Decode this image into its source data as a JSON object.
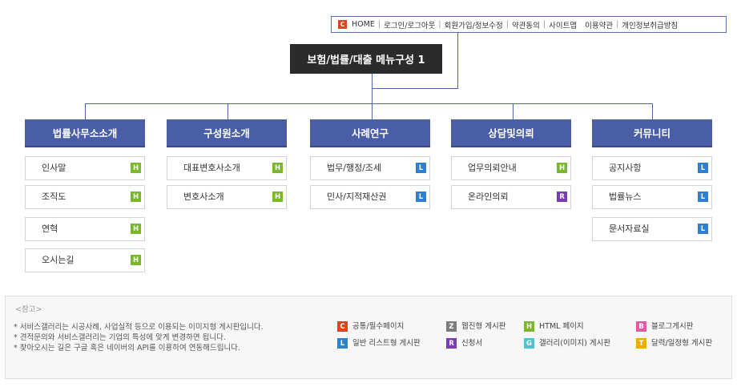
{
  "topnav": {
    "badge": "C",
    "links": [
      "HOME",
      "로그인/로그아웃",
      "회원가입/정보수정",
      "약관동의",
      "사이트맵",
      "이용약관",
      "개인정보취급방침"
    ]
  },
  "title": "보험/법률/대출 메뉴구성 1",
  "categories": [
    {
      "label": "법률사무소소개",
      "items": [
        {
          "label": "인사말",
          "badge": "H"
        },
        {
          "label": "조직도",
          "badge": "H"
        },
        {
          "label": "연혁",
          "badge": "H"
        },
        {
          "label": "오시는길",
          "badge": "H"
        }
      ]
    },
    {
      "label": "구성원소개",
      "items": [
        {
          "label": "대표변호사소개",
          "badge": "H"
        },
        {
          "label": "변호사소개",
          "badge": "H"
        }
      ]
    },
    {
      "label": "사례연구",
      "items": [
        {
          "label": "법무/행정/조세",
          "badge": "L"
        },
        {
          "label": "민사/지적재산권",
          "badge": "L"
        }
      ]
    },
    {
      "label": "상담및의뢰",
      "items": [
        {
          "label": "업무의뢰안내",
          "badge": "H"
        },
        {
          "label": "온라인의뢰",
          "badge": "R"
        }
      ]
    },
    {
      "label": "커뮤니티",
      "items": [
        {
          "label": "공지사항",
          "badge": "L"
        },
        {
          "label": "법률뉴스",
          "badge": "L"
        },
        {
          "label": "문서자료실",
          "badge": "L"
        }
      ]
    }
  ],
  "reference": {
    "heading": "<참고>",
    "notes": [
      "* 서비스갤러리는 시공사례, 사업실적 등으로 이용되는 이미지형 게시판입니다.",
      "* 견적문의와 서비스갤러리는 기업의 특성에 맞게 변경하면 됩니다.",
      "* 찾아오시는 길은 구글 혹은 네이버의 API를 이용하여 연동해드립니다."
    ],
    "legend": [
      {
        "badge": "C",
        "label": "공통/필수페이지"
      },
      {
        "badge": "Z",
        "label": "웹진형 게시판"
      },
      {
        "badge": "H",
        "label": "HTML 페이지"
      },
      {
        "badge": "B",
        "label": "블로그게시판"
      },
      {
        "badge": "L",
        "label": "일반 리스트형 게시판"
      },
      {
        "badge": "R",
        "label": "신청서"
      },
      {
        "badge": "G",
        "label": "갤러리(이미지) 게시판"
      },
      {
        "badge": "T",
        "label": "달력/일정형 게시판"
      }
    ]
  },
  "colors": {
    "C": "#e8401c",
    "Z": "#7d7d7d",
    "H": "#78b82a",
    "B": "#e25ba6",
    "L": "#2d7fd1",
    "R": "#7a3bb5",
    "G": "#4fc3d0",
    "T": "#f0a900",
    "accent": "#4a5ea8"
  }
}
